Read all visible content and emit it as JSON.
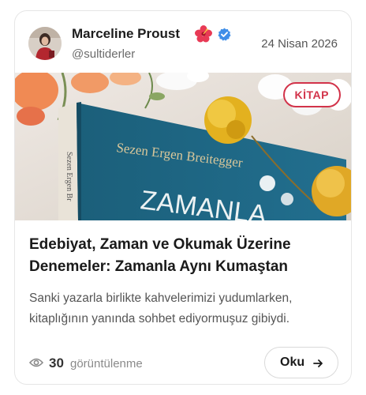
{
  "post": {
    "author": {
      "name": "Marceline Proust",
      "emoji": "🌺",
      "handle": "@sultiderler",
      "verified": true,
      "avatar": "avatar"
    },
    "date": "24 Nisan 2026",
    "tag": "KİTAP",
    "cover": {
      "book_author": "Sezen Ergen Breitegger",
      "book_title_fragment": "ZAMANLA",
      "spine_text": "Sezen Ergen Br"
    },
    "title": "Edebiyat, Zaman ve Okumak Üzerine Denemeler: Zamanla Aynı Kumaştan",
    "excerpt": "Sanki yazarla birlikte kahvelerimizi yudumlarken, kitaplığının yanında sohbet ediyormuşuz gibiydi.",
    "views": {
      "count": "30",
      "label": "görüntülenme",
      "icon": "eye-icon"
    },
    "read_button": {
      "label": "Oku",
      "icon": "arrow-right-icon"
    }
  },
  "colors": {
    "accent": "#d2334a",
    "verified": "#3f8ee8",
    "book_cover": "#1f6f8b",
    "title_text": "#1a1a1a"
  }
}
